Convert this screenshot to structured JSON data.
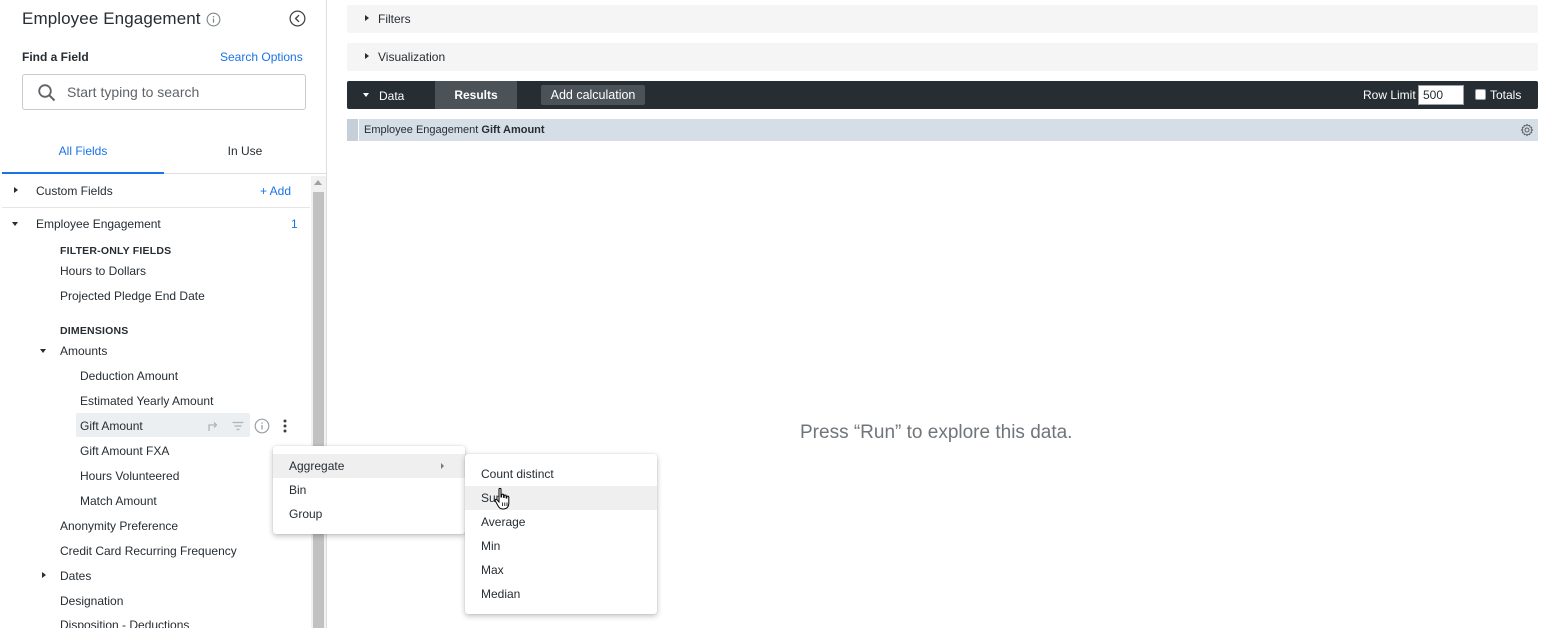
{
  "sidebar": {
    "title": "Employee Engagement",
    "find_label": "Find a Field",
    "search_options": "Search Options",
    "search_placeholder": "Start typing to search",
    "tabs": {
      "all_fields": "All Fields",
      "in_use": "In Use"
    },
    "custom_fields": {
      "label": "Custom Fields",
      "add": "+ Add"
    },
    "view": {
      "label": "Employee Engagement",
      "count": "1"
    },
    "filter_only_header": "FILTER-ONLY FIELDS",
    "filter_only": [
      "Hours to Dollars",
      "Projected Pledge End Date"
    ],
    "dimensions_header": "DIMENSIONS",
    "amounts_group": "Amounts",
    "amount_fields": [
      "Deduction Amount",
      "Estimated Yearly Amount",
      "Gift Amount",
      "Gift Amount FXA",
      "Hours Volunteered",
      "Match Amount"
    ],
    "other_fields": [
      "Anonymity Preference",
      "Credit Card Recurring Frequency",
      "Dates",
      "Designation",
      "Disposition - Deductions"
    ]
  },
  "main": {
    "filters": "Filters",
    "visualization": "Visualization",
    "data": "Data",
    "results": "Results",
    "add_calculation": "Add calculation",
    "row_limit_label": "Row Limit",
    "row_limit_value": "500",
    "totals": "Totals",
    "column_view": "Employee Engagement",
    "column_field": "Gift Amount",
    "empty_message": "Press “Run” to explore this data."
  },
  "context_menu": {
    "items": [
      "Aggregate",
      "Bin",
      "Group"
    ]
  },
  "aggregate_submenu": {
    "items": [
      "Count distinct",
      "Sum",
      "Average",
      "Min",
      "Max",
      "Median"
    ],
    "hovered": "Sum"
  },
  "colors": {
    "accent": "#1a73e8",
    "data_bar": "#262d33",
    "results_tab": "#4b5359",
    "column_header": "#d5dde6"
  }
}
